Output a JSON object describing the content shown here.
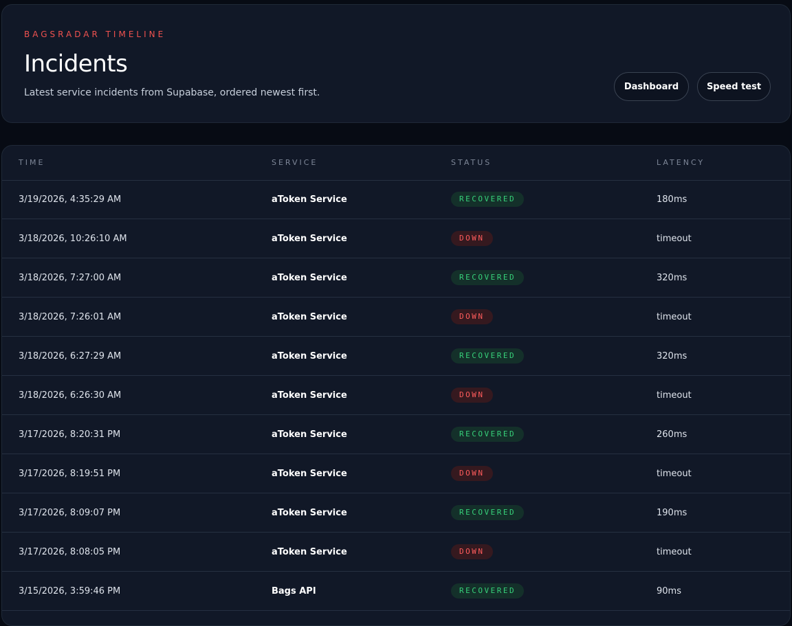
{
  "header": {
    "eyebrow": "BAGSRADAR TIMELINE",
    "title": "Incidents",
    "subtitle": "Latest service incidents from Supabase, ordered newest first.",
    "buttons": {
      "dashboard": "Dashboard",
      "speed_test": "Speed test"
    }
  },
  "table": {
    "columns": {
      "time": "TIME",
      "service": "SERVICE",
      "status": "STATUS",
      "latency": "LATENCY"
    },
    "rows": [
      {
        "time": "3/19/2026, 4:35:29 AM",
        "service": "aToken Service",
        "status": "RECOVERED",
        "latency": "180ms"
      },
      {
        "time": "3/18/2026, 10:26:10 AM",
        "service": "aToken Service",
        "status": "DOWN",
        "latency": "timeout"
      },
      {
        "time": "3/18/2026, 7:27:00 AM",
        "service": "aToken Service",
        "status": "RECOVERED",
        "latency": "320ms"
      },
      {
        "time": "3/18/2026, 7:26:01 AM",
        "service": "aToken Service",
        "status": "DOWN",
        "latency": "timeout"
      },
      {
        "time": "3/18/2026, 6:27:29 AM",
        "service": "aToken Service",
        "status": "RECOVERED",
        "latency": "320ms"
      },
      {
        "time": "3/18/2026, 6:26:30 AM",
        "service": "aToken Service",
        "status": "DOWN",
        "latency": "timeout"
      },
      {
        "time": "3/17/2026, 8:20:31 PM",
        "service": "aToken Service",
        "status": "RECOVERED",
        "latency": "260ms"
      },
      {
        "time": "3/17/2026, 8:19:51 PM",
        "service": "aToken Service",
        "status": "DOWN",
        "latency": "timeout"
      },
      {
        "time": "3/17/2026, 8:09:07 PM",
        "service": "aToken Service",
        "status": "RECOVERED",
        "latency": "190ms"
      },
      {
        "time": "3/17/2026, 8:08:05 PM",
        "service": "aToken Service",
        "status": "DOWN",
        "latency": "timeout"
      },
      {
        "time": "3/15/2026, 3:59:46 PM",
        "service": "Bags API",
        "status": "RECOVERED",
        "latency": "90ms"
      }
    ]
  },
  "colors": {
    "accent": "#f0524f",
    "recovered": "#37d17a",
    "down": "#ff5c5c",
    "card": "#111827",
    "background": "#070b14"
  }
}
